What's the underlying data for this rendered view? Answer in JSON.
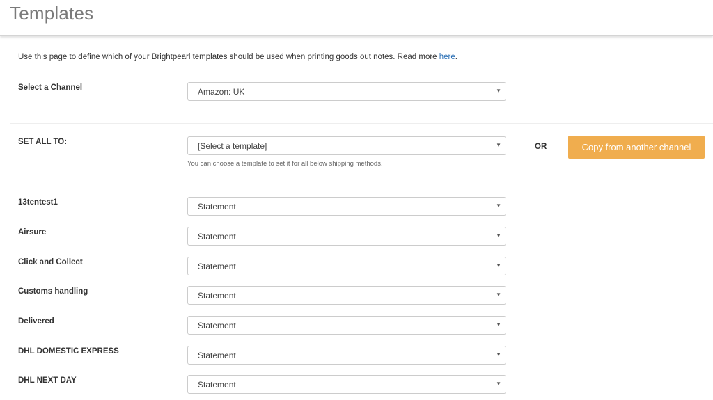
{
  "header": {
    "title": "Templates"
  },
  "intro": {
    "text": "Use this page to define which of your Brightpearl templates should be used when printing goods out notes. Read more ",
    "link": "here",
    "suffix": "."
  },
  "channel": {
    "label": "Select a Channel",
    "value": "Amazon: UK"
  },
  "set_all": {
    "label": "SET ALL TO:",
    "value": "[Select a template]",
    "hint": "You can choose a template to set it for all below shipping methods.",
    "or_label": "OR",
    "copy_button": "Copy from another channel"
  },
  "shipping_methods": [
    {
      "label": "13tentest1",
      "value": "Statement"
    },
    {
      "label": "Airsure",
      "value": "Statement"
    },
    {
      "label": "Click and Collect",
      "value": "Statement"
    },
    {
      "label": "Customs handling",
      "value": "Statement"
    },
    {
      "label": "Delivered",
      "value": "Statement"
    },
    {
      "label": "DHL DOMESTIC EXPRESS",
      "value": "Statement"
    },
    {
      "label": "DHL NEXT DAY",
      "value": "Statement"
    }
  ],
  "icons": {
    "dropdown": "caret-down-icon"
  },
  "colors": {
    "accent": "#f0ad4e",
    "link": "#2a6fb5",
    "title": "#7a7a7a"
  }
}
